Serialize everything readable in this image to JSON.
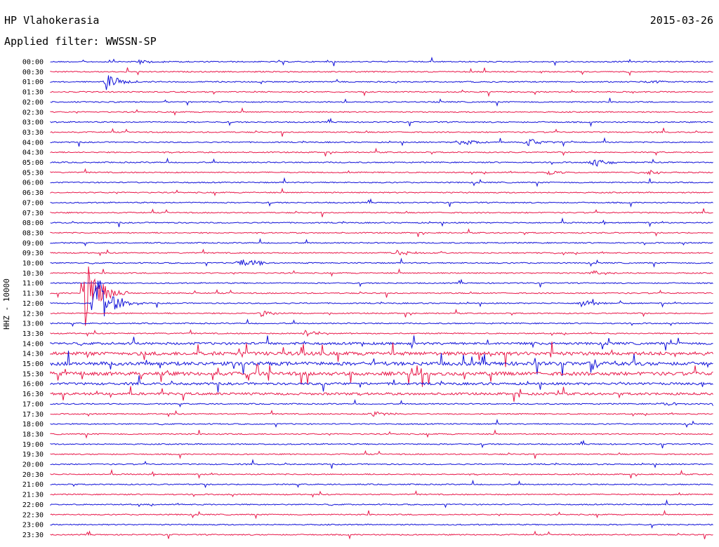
{
  "header": {
    "station": "HP Vlahokerasia",
    "date": "2015-03-26",
    "filter": "Applied filter: WWSSN-SP"
  },
  "axis": {
    "ylabel": "HHZ - 10000"
  },
  "colors": {
    "even_trace": "#1010d8",
    "odd_trace": "#e8184a"
  },
  "chart_data": {
    "type": "line",
    "title": "HP Vlahokerasia",
    "ylabel": "HHZ - 10000",
    "row_labels": [
      "00:00",
      "00:30",
      "01:00",
      "01:30",
      "02:00",
      "02:30",
      "03:00",
      "03:30",
      "04:00",
      "04:30",
      "05:00",
      "05:30",
      "06:00",
      "06:30",
      "07:00",
      "07:30",
      "08:00",
      "08:30",
      "09:00",
      "09:30",
      "10:00",
      "10:30",
      "11:00",
      "11:30",
      "12:00",
      "12:30",
      "13:00",
      "13:30",
      "14:00",
      "14:30",
      "15:00",
      "15:30",
      "16:00",
      "16:30",
      "17:00",
      "17:30",
      "18:00",
      "18:30",
      "19:00",
      "19:30",
      "20:00",
      "20:30",
      "21:00",
      "21:30",
      "22:00",
      "22:30",
      "23:00",
      "23:30"
    ],
    "row_duration_minutes": 30,
    "noise_level": [
      1,
      1,
      1,
      1,
      1,
      1,
      1,
      1,
      1,
      1,
      1,
      1,
      1,
      1,
      1,
      1,
      1,
      1,
      1,
      1,
      1,
      1,
      1,
      1,
      1,
      1,
      1,
      1,
      2,
      3,
      3,
      3,
      2,
      2,
      1,
      1,
      1,
      1,
      1,
      1,
      1,
      1,
      1,
      1,
      1,
      1,
      1,
      1
    ],
    "events": [
      {
        "row": "00:00",
        "minute": 4,
        "amplitude": 4
      },
      {
        "row": "01:00",
        "minute": 2.5,
        "amplitude": 12
      },
      {
        "row": "01:00",
        "minute": 27,
        "amplitude": 3
      },
      {
        "row": "04:00",
        "minute": 18.5,
        "amplitude": 8
      },
      {
        "row": "04:00",
        "minute": 21.5,
        "amplitude": 6
      },
      {
        "row": "05:00",
        "minute": 24.5,
        "amplitude": 7
      },
      {
        "row": "05:30",
        "minute": 22.5,
        "amplitude": 4
      },
      {
        "row": "05:30",
        "minute": 27,
        "amplitude": 4
      },
      {
        "row": "09:30",
        "minute": 15.5,
        "amplitude": 6
      },
      {
        "row": "10:00",
        "minute": 8.5,
        "amplitude": 10
      },
      {
        "row": "10:30",
        "minute": 24.5,
        "amplitude": 4
      },
      {
        "row": "11:30",
        "minute": 1.5,
        "amplitude": 55
      },
      {
        "row": "12:00",
        "minute": 2,
        "amplitude": 45
      },
      {
        "row": "12:00",
        "minute": 24,
        "amplitude": 6
      },
      {
        "row": "12:30",
        "minute": 9.5,
        "amplitude": 5
      },
      {
        "row": "13:30",
        "minute": 11.5,
        "amplitude": 6
      },
      {
        "row": "17:00",
        "minute": 27.5,
        "amplitude": 4
      },
      {
        "row": "17:30",
        "minute": 14.5,
        "amplitude": 5
      }
    ]
  }
}
